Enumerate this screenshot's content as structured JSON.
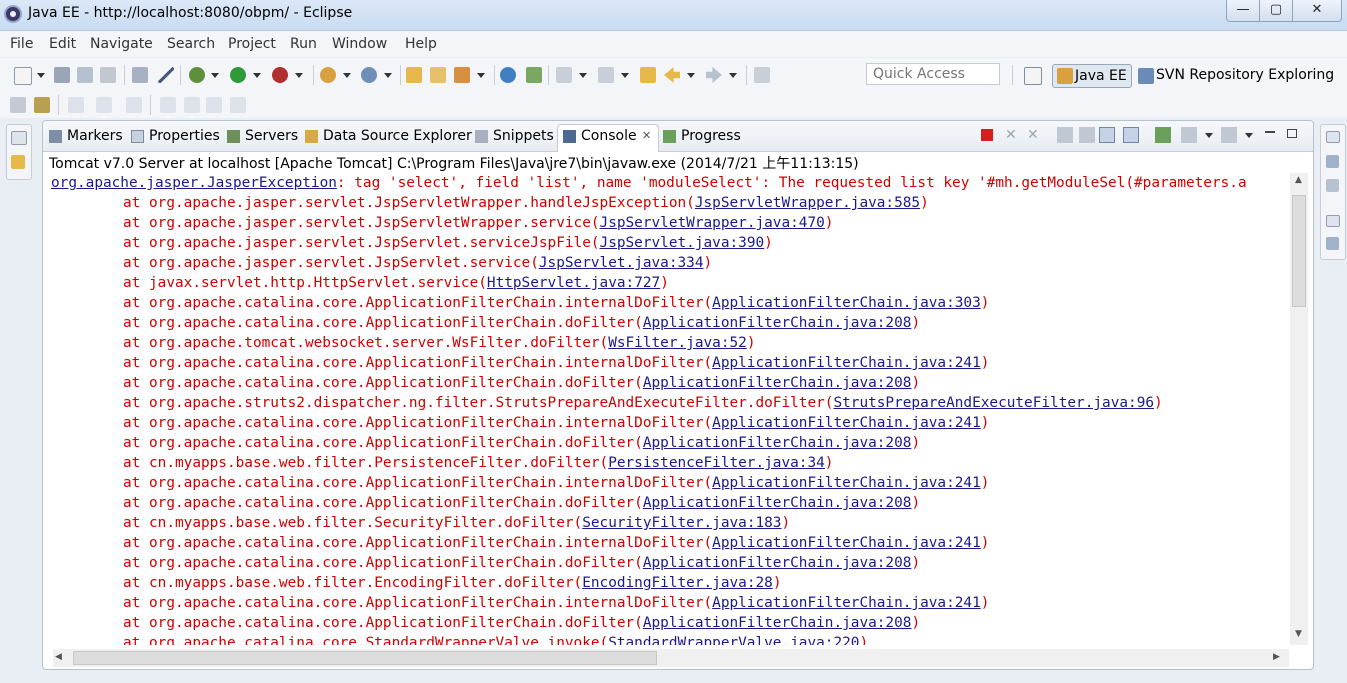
{
  "window": {
    "title": "Java EE - http://localhost:8080/obpm/ - Eclipse",
    "minimize": "—",
    "maximize": "▢",
    "close": "✕"
  },
  "menu": [
    "File",
    "Edit",
    "Navigate",
    "Search",
    "Project",
    "Run",
    "Window",
    "Help"
  ],
  "toolbar": {
    "quick_access_placeholder": "Quick Access",
    "perspectives": [
      "Java EE",
      "SVN Repository Exploring"
    ]
  },
  "tabs": [
    {
      "label": "Markers",
      "icon": "markers-icon"
    },
    {
      "label": "Properties",
      "icon": "properties-icon"
    },
    {
      "label": "Servers",
      "icon": "servers-icon"
    },
    {
      "label": "Data Source Explorer",
      "icon": "data-source-icon"
    },
    {
      "label": "Snippets",
      "icon": "snippets-icon"
    },
    {
      "label": "Console",
      "icon": "console-icon",
      "active": true
    },
    {
      "label": "Progress",
      "icon": "progress-icon"
    }
  ],
  "console": {
    "header": "Tomcat v7.0 Server at localhost [Apache Tomcat] C:\\Program Files\\Java\\jre7\\bin\\javaw.exe (2014/7/21 上午11:13:15)",
    "lines": [
      {
        "indent": false,
        "pre": "",
        "text": "",
        "link": "org.apache.jasper.JasperException",
        "post": ": tag 'select', field 'list', name 'moduleSelect': The requested list key '#mh.getModuleSel(#parameters.a"
      },
      {
        "indent": true,
        "pre": "at ",
        "text": "org.apache.jasper.servlet.JspServletWrapper.handleJspException(",
        "link": "JspServletWrapper.java:585",
        "post": ")"
      },
      {
        "indent": true,
        "pre": "at ",
        "text": "org.apache.jasper.servlet.JspServletWrapper.service(",
        "link": "JspServletWrapper.java:470",
        "post": ")"
      },
      {
        "indent": true,
        "pre": "at ",
        "text": "org.apache.jasper.servlet.JspServlet.serviceJspFile(",
        "link": "JspServlet.java:390",
        "post": ")"
      },
      {
        "indent": true,
        "pre": "at ",
        "text": "org.apache.jasper.servlet.JspServlet.service(",
        "link": "JspServlet.java:334",
        "post": ")"
      },
      {
        "indent": true,
        "pre": "at ",
        "text": "javax.servlet.http.HttpServlet.service(",
        "link": "HttpServlet.java:727",
        "post": ")"
      },
      {
        "indent": true,
        "pre": "at ",
        "text": "org.apache.catalina.core.ApplicationFilterChain.internalDoFilter(",
        "link": "ApplicationFilterChain.java:303",
        "post": ")"
      },
      {
        "indent": true,
        "pre": "at ",
        "text": "org.apache.catalina.core.ApplicationFilterChain.doFilter(",
        "link": "ApplicationFilterChain.java:208",
        "post": ")"
      },
      {
        "indent": true,
        "pre": "at ",
        "text": "org.apache.tomcat.websocket.server.WsFilter.doFilter(",
        "link": "WsFilter.java:52",
        "post": ")"
      },
      {
        "indent": true,
        "pre": "at ",
        "text": "org.apache.catalina.core.ApplicationFilterChain.internalDoFilter(",
        "link": "ApplicationFilterChain.java:241",
        "post": ")"
      },
      {
        "indent": true,
        "pre": "at ",
        "text": "org.apache.catalina.core.ApplicationFilterChain.doFilter(",
        "link": "ApplicationFilterChain.java:208",
        "post": ")"
      },
      {
        "indent": true,
        "pre": "at ",
        "text": "org.apache.struts2.dispatcher.ng.filter.StrutsPrepareAndExecuteFilter.doFilter(",
        "link": "StrutsPrepareAndExecuteFilter.java:96",
        "post": ")"
      },
      {
        "indent": true,
        "pre": "at ",
        "text": "org.apache.catalina.core.ApplicationFilterChain.internalDoFilter(",
        "link": "ApplicationFilterChain.java:241",
        "post": ")"
      },
      {
        "indent": true,
        "pre": "at ",
        "text": "org.apache.catalina.core.ApplicationFilterChain.doFilter(",
        "link": "ApplicationFilterChain.java:208",
        "post": ")"
      },
      {
        "indent": true,
        "pre": "at ",
        "text": "cn.myapps.base.web.filter.PersistenceFilter.doFilter(",
        "link": "PersistenceFilter.java:34",
        "post": ")"
      },
      {
        "indent": true,
        "pre": "at ",
        "text": "org.apache.catalina.core.ApplicationFilterChain.internalDoFilter(",
        "link": "ApplicationFilterChain.java:241",
        "post": ")"
      },
      {
        "indent": true,
        "pre": "at ",
        "text": "org.apache.catalina.core.ApplicationFilterChain.doFilter(",
        "link": "ApplicationFilterChain.java:208",
        "post": ")"
      },
      {
        "indent": true,
        "pre": "at ",
        "text": "cn.myapps.base.web.filter.SecurityFilter.doFilter(",
        "link": "SecurityFilter.java:183",
        "post": ")"
      },
      {
        "indent": true,
        "pre": "at ",
        "text": "org.apache.catalina.core.ApplicationFilterChain.internalDoFilter(",
        "link": "ApplicationFilterChain.java:241",
        "post": ")"
      },
      {
        "indent": true,
        "pre": "at ",
        "text": "org.apache.catalina.core.ApplicationFilterChain.doFilter(",
        "link": "ApplicationFilterChain.java:208",
        "post": ")"
      },
      {
        "indent": true,
        "pre": "at ",
        "text": "cn.myapps.base.web.filter.EncodingFilter.doFilter(",
        "link": "EncodingFilter.java:28",
        "post": ")"
      },
      {
        "indent": true,
        "pre": "at ",
        "text": "org.apache.catalina.core.ApplicationFilterChain.internalDoFilter(",
        "link": "ApplicationFilterChain.java:241",
        "post": ")"
      },
      {
        "indent": true,
        "pre": "at ",
        "text": "org.apache.catalina.core.ApplicationFilterChain.doFilter(",
        "link": "ApplicationFilterChain.java:208",
        "post": ")"
      },
      {
        "indent": true,
        "pre": "at ",
        "text": "org.apache.catalina.core.StandardWrapperValve.invoke(",
        "link": "StandardWrapperValve.java:220",
        "post": ")"
      }
    ]
  },
  "colors": {
    "error_text": "#d00000",
    "link": "#1a1a8c"
  }
}
